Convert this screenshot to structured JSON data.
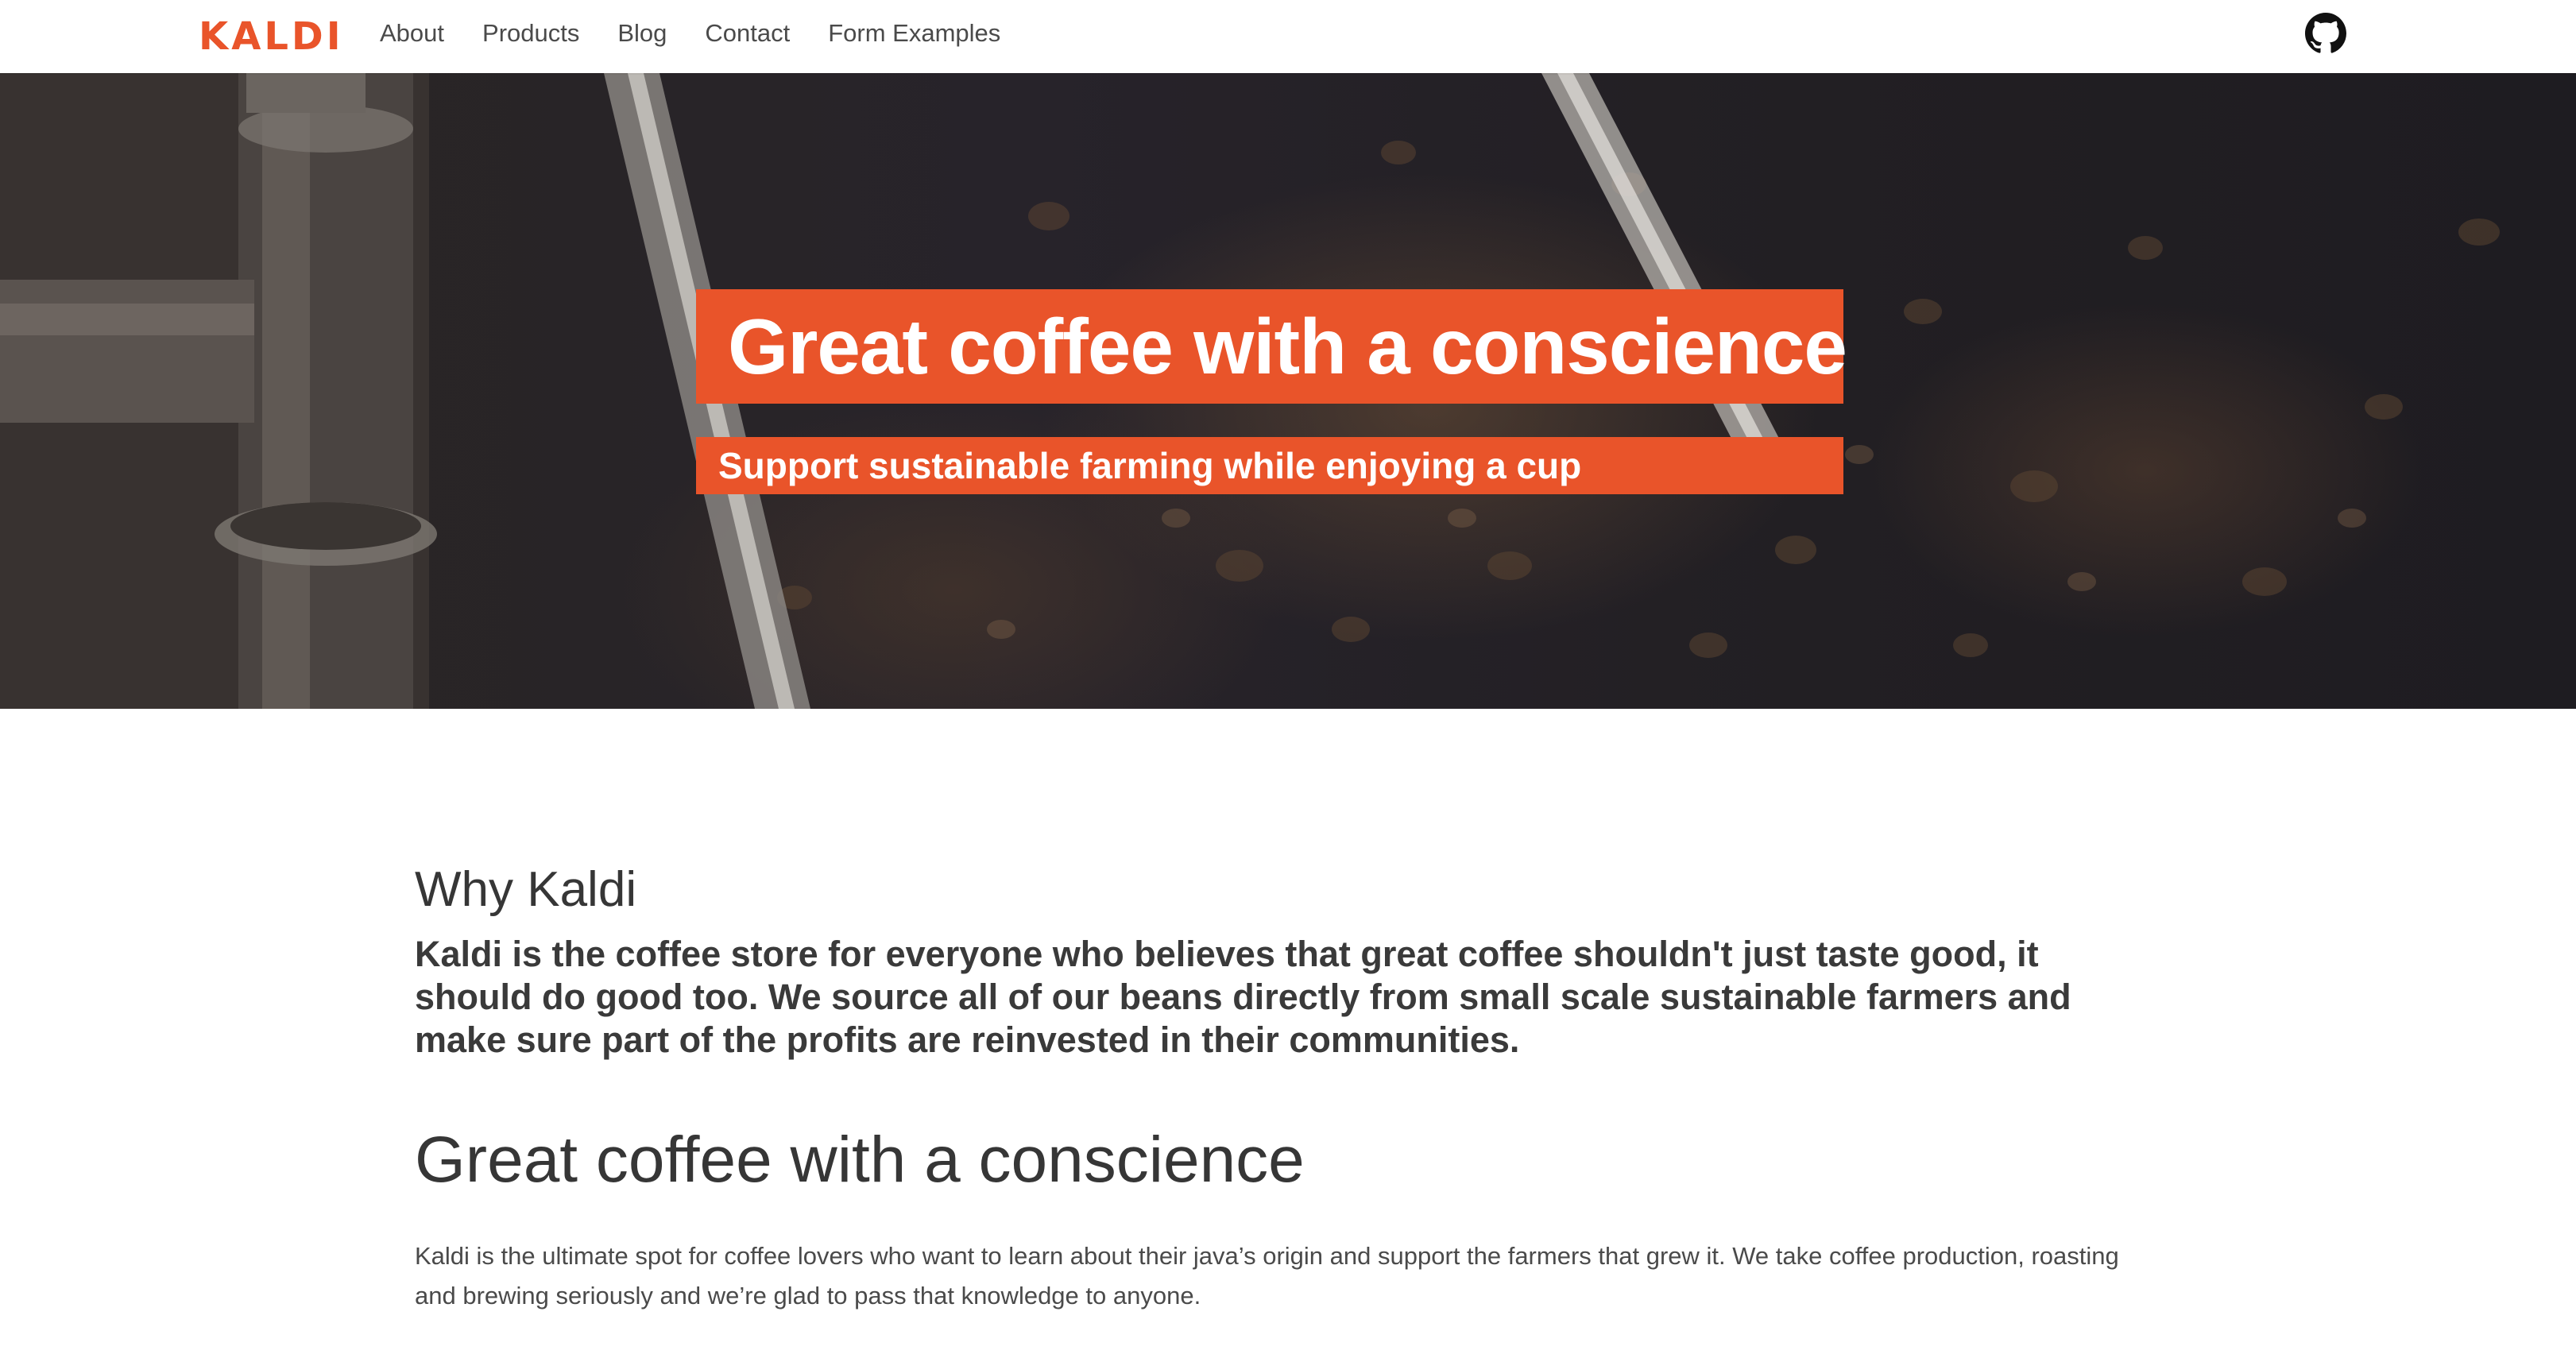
{
  "nav": {
    "brand": "KALDI",
    "links": [
      "About",
      "Products",
      "Blog",
      "Contact",
      "Form Examples"
    ],
    "github_icon": "github-icon"
  },
  "hero": {
    "title": "Great coffee with a conscience",
    "subtitle": "Support sustainable farming while enjoying a cup"
  },
  "intro": {
    "heading": "Why Kaldi",
    "lead": "Kaldi is the coffee store for everyone who believes that great coffee shouldn't just taste good, it should do good too. We source all of our beans directly from small scale sustainable farmers and make sure part of the profits are reinvested in their communities."
  },
  "section": {
    "heading": "Great coffee with a conscience",
    "body": "Kaldi is the ultimate spot for coffee lovers who want to learn about their java’s origin and support the farmers that grew it. We take coffee production, roasting and brewing seriously and we’re glad to pass that knowledge to anyone."
  },
  "colors": {
    "accent": "#e9542a",
    "text": "#363636"
  }
}
